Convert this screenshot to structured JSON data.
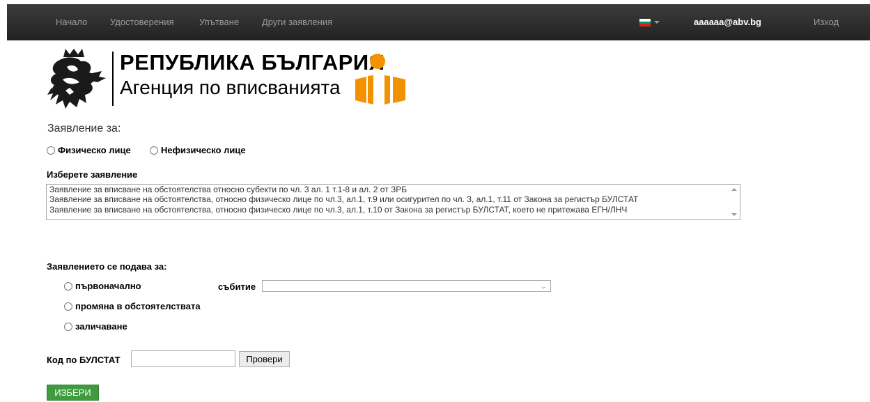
{
  "nav": {
    "items": [
      "Начало",
      "Удостоверения",
      "Упътване",
      "Други заявления"
    ],
    "user_email": "aaaaaa@abv.bg",
    "logout": "Изход",
    "flag_colors": [
      "#ffffff",
      "#00966e",
      "#d62612"
    ]
  },
  "logo": {
    "line1": "РЕПУБЛИКА БЪЛГАРИЯ",
    "line2": "Агенция по вписванията",
    "accent": "#f39200"
  },
  "form": {
    "heading": "Заявление за:",
    "person_types": [
      "Физическо лице",
      "Нефизическо лице"
    ],
    "choose_label": "Изберете заявление",
    "applications": [
      "Заявление за вписване на обстоятелства относно субекти по чл. 3 ал. 1 т.1-8 и ал. 2 от ЗРБ",
      "Заявление за вписване на обстоятелства, относно физическо лице по чл.3, ал.1, т.9 или осигурител по чл. 3, ал.1, т.11 от Закона за регистър БУЛСТАТ",
      "Заявление за вписване на обстоятелства, относно физическо лице по чл.3, ал.1, т.10 от Закона за регистър БУЛСТАТ, което не притежава ЕГН/ЛНЧ"
    ],
    "submitted_for_label": "Заявлението се подава за:",
    "submit_options": [
      "първоначално",
      "промяна в обстоятелствата",
      "заличаване"
    ],
    "event_label": "събитие",
    "event_value": "",
    "bulstat_label": "Код по БУЛСТАТ",
    "bulstat_value": "",
    "check_button": "Провери",
    "select_button": "ИЗБЕРИ",
    "select_button_color": "#3e9c3e"
  }
}
